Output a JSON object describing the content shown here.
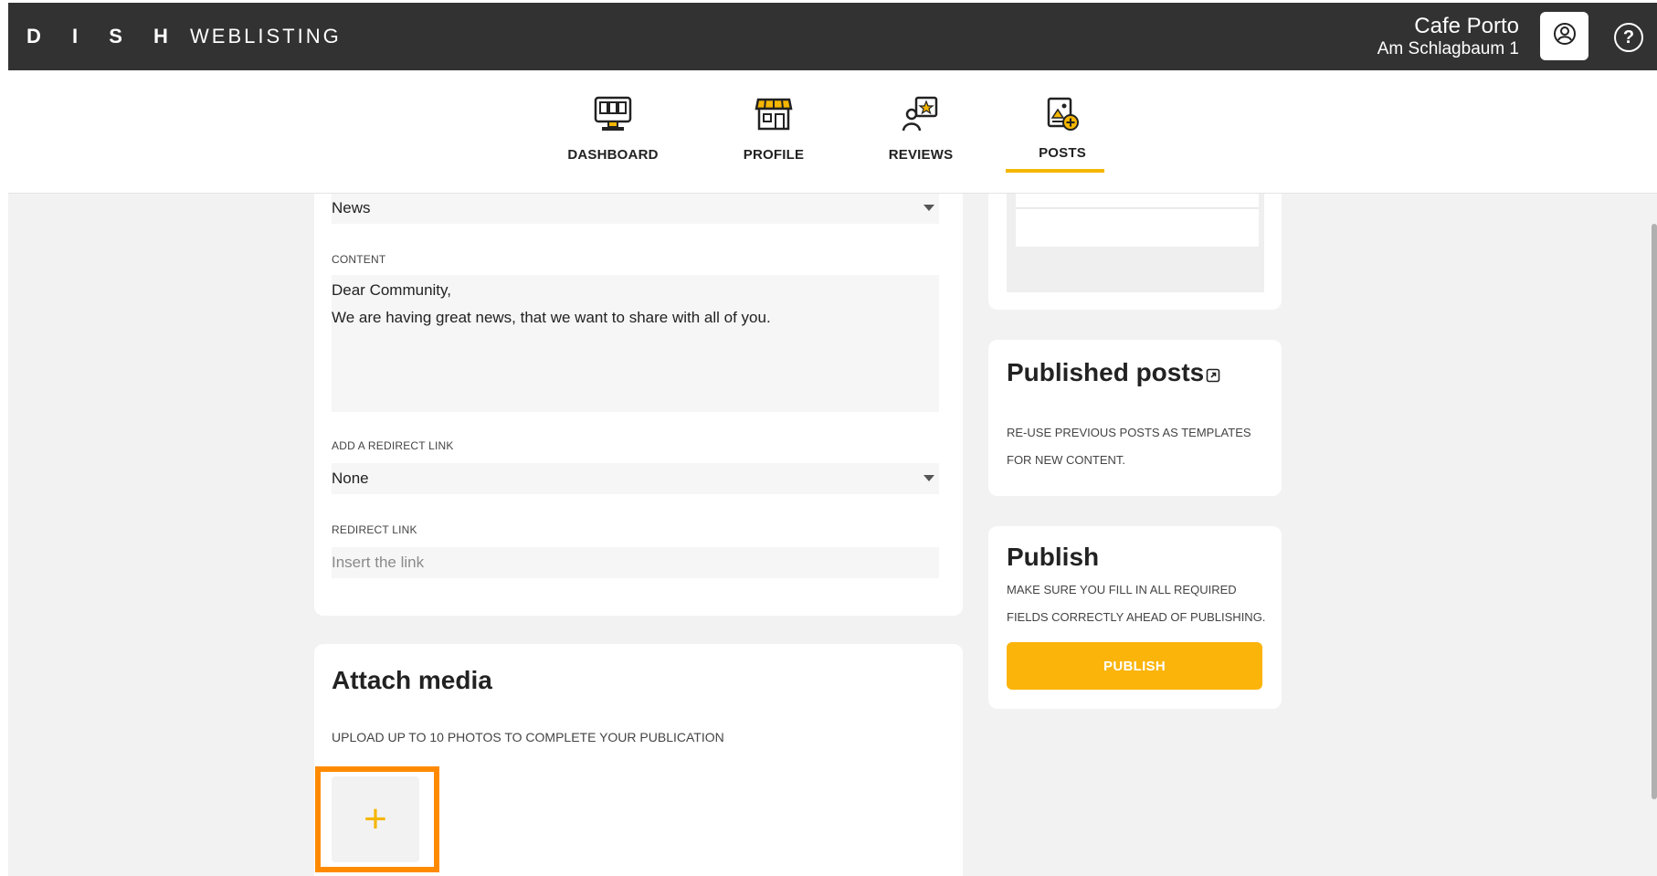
{
  "header": {
    "logo_brand": "D I S H",
    "logo_product": "WEBLISTING",
    "venue_name": "Cafe Porto",
    "venue_address": "Am Schlagbaum 1",
    "user_icon": "user-circle-icon",
    "help_icon": "help-circle-icon",
    "help_symbol": "?"
  },
  "nav": {
    "items": [
      {
        "label": "DASHBOARD",
        "icon": "dashboard-monitor-icon",
        "active": false
      },
      {
        "label": "PROFILE",
        "icon": "storefront-icon",
        "active": false
      },
      {
        "label": "REVIEWS",
        "icon": "reviews-star-icon",
        "active": false
      },
      {
        "label": "POSTS",
        "icon": "posts-add-icon",
        "active": true
      }
    ],
    "accent_color": "#f5b600"
  },
  "form": {
    "type_value": "News",
    "content_label": "CONTENT",
    "content_line1": "Dear Community,",
    "content_line2": "We are having great news, that we want to share with all of you.",
    "redirect_type_label": "ADD A REDIRECT LINK",
    "redirect_type_value": "None",
    "redirect_link_label": "REDIRECT LINK",
    "redirect_link_placeholder": "Insert the link"
  },
  "media": {
    "title": "Attach media",
    "subtitle": "UPLOAD UP TO 10 PHOTOS TO COMPLETE YOUR PUBLICATION",
    "add_symbol": "+"
  },
  "published_posts": {
    "title": "Published posts",
    "link_icon": "external-link-icon",
    "description": "RE-USE PREVIOUS POSTS AS TEMPLATES FOR NEW CONTENT."
  },
  "publish": {
    "title": "Publish",
    "description": "MAKE SURE YOU FILL IN ALL REQUIRED FIELDS CORRECTLY AHEAD OF PUBLISHING.",
    "button_label": "PUBLISH",
    "button_color": "#fbb40a"
  }
}
